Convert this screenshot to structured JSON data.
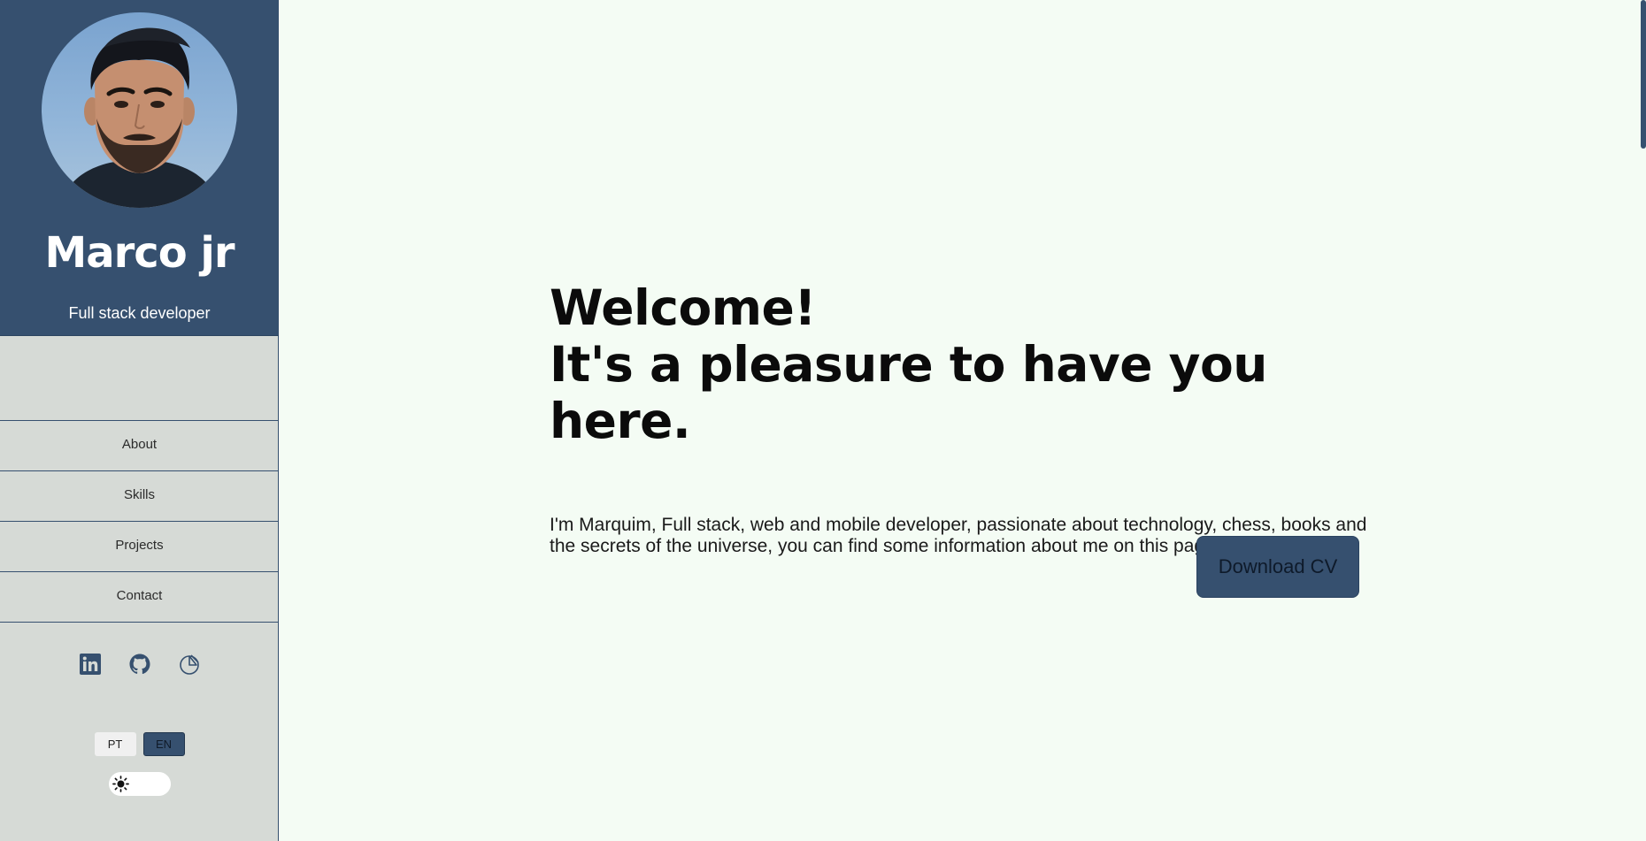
{
  "profile": {
    "name": "Marco jr",
    "role": "Full stack developer"
  },
  "nav": {
    "items": [
      {
        "label": "About"
      },
      {
        "label": "Skills"
      },
      {
        "label": "Projects"
      },
      {
        "label": "Contact"
      }
    ]
  },
  "social": {
    "icons": [
      "linkedin-icon",
      "github-icon",
      "portfolio-icon"
    ]
  },
  "language": {
    "options": [
      "PT",
      "EN"
    ],
    "selected": "EN"
  },
  "theme": {
    "icon": "sun-icon",
    "mode": "light"
  },
  "hero": {
    "title_line1": "Welcome!",
    "title_line2": "It's a pleasure to have you here.",
    "description": "I'm Marquim, Full stack, web and mobile developer, passionate about technology, chess, books and the secrets of the universe, you can find some information about me on this page.",
    "cv_button": "Download CV"
  },
  "colors": {
    "accent": "#36506f",
    "sidebar_bg": "#d6dad6",
    "page_bg": "#f4fcf4",
    "text": "#0b0b0b"
  }
}
